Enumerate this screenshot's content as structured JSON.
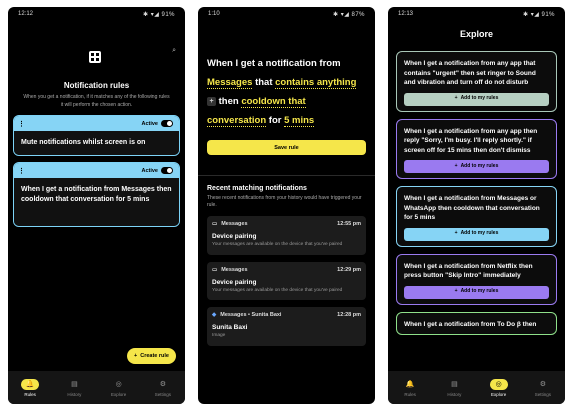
{
  "screen1": {
    "time": "12:12",
    "status_icons": "✱ ▾◢ 91%",
    "title": "Notification rules",
    "description": "When you get a notification, if it matches any of the following rules it will perform the chosen action.",
    "rules": [
      {
        "menu": "⋮",
        "status": "Active",
        "text": "Mute notifications whilst screen is on"
      },
      {
        "menu": "⋮",
        "status": "Active",
        "text": "When I get a notification from Messages then cooldown that conversation for 5 mins"
      }
    ],
    "fab_label": "Create rule",
    "nav": [
      {
        "label": "Rules",
        "icon": "bell-icon",
        "glyph": "🔔"
      },
      {
        "label": "History",
        "icon": "history-icon",
        "glyph": "▤"
      },
      {
        "label": "Explore",
        "icon": "explore-icon",
        "glyph": "◎"
      },
      {
        "label": "Settings",
        "icon": "settings-icon",
        "glyph": "⚙"
      }
    ]
  },
  "screen2": {
    "time": "1:10",
    "status_icons": "✱ ▾◢ 87%",
    "rule": {
      "p1": "When I get a notification from",
      "app": "Messages",
      "p2": "that",
      "cond": "contains anything",
      "plus": "+",
      "p3": "then",
      "action": "cooldown that conversation",
      "p4": "for",
      "dur": "5 mins"
    },
    "save_label": "Save rule",
    "recent_title": "Recent matching notifications",
    "recent_desc": "These recent notifications from your history would have triggered your rule.",
    "notifications": [
      {
        "app": "Messages",
        "time": "12:55 pm",
        "title": "Device pairing",
        "body": "Your messages are available on the device that you've paired"
      },
      {
        "app": "Messages",
        "time": "12:29 pm",
        "title": "Device pairing",
        "body": "Your messages are available on the device that you've paired"
      },
      {
        "app": "Messages • Sunita Baxi",
        "time": "12:28 pm",
        "title": "Sunita Baxi",
        "body": "Image"
      }
    ]
  },
  "screen3": {
    "time": "12:13",
    "status_icons": "✱ ▾◢ 91%",
    "title": "Explore",
    "add_label": "Add to my rules",
    "cards": [
      {
        "text": "When I get a notification from any app that contains \"urgent\" then set ringer to Sound and vibration and turn off do not disturb",
        "color": "gray"
      },
      {
        "text": "When I get a notification from any app then reply \"Sorry, I'm busy. I'll reply shortly.\" if screen off for 15 mins then don't dismiss",
        "color": "purple"
      },
      {
        "text": "When I get a notification from Messages or WhatsApp then cooldown that conversation for 5 mins",
        "color": "blue"
      },
      {
        "text": "When I get a notification from Netflix then press button \"Skip Intro\" immediately",
        "color": "purple"
      },
      {
        "text": "When I get a notification from To Do β then",
        "color": "green"
      }
    ]
  }
}
